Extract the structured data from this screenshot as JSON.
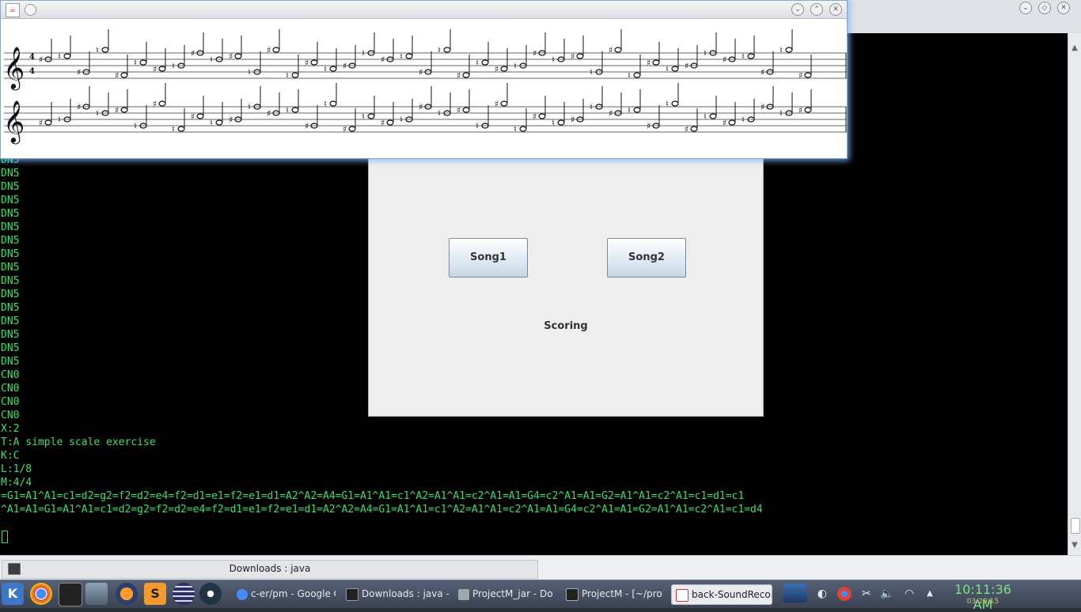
{
  "terminal": {
    "lines": [
      "DN5",
      "DN5",
      "DN5",
      "DN5",
      "DN5",
      "DN5",
      "DN5",
      "DN5",
      "DN5",
      "DN5",
      "DN5",
      "DN5",
      "DN5",
      "DN5",
      "DN5",
      "DN5",
      "CN0",
      "CN0",
      "CN0",
      "CN0",
      "X:2",
      "T:A simple scale exercise",
      "K:C",
      "L:1/8",
      "M:4/4",
      "=G1=A1^A1=c1=d2=g2=f2=d2=e4=f2=d1=e1=f2=e1=d1=A2^A2=A4=G1=A1^A1=c1^A2=A1^A1=c2^A1=A1=G4=c2^A1=A1=G2=A1^A1=c2^A1=c1=d1=c1",
      "^A1=A1=G1=A1^A1=c1=d2=g2=f2=d2=e4=f2=d1=e1=f2=e1=d1=A2^A2=A4=G1=A1^A1=c1^A2=A1^A1=c2^A1=A1=G4=c2^A1=A1=G2=A1^A1=c2^A1=c1=d4"
    ]
  },
  "main_window": {
    "song1_label": "Song1",
    "song2_label": "Song2",
    "scoring_label": "Scoring"
  },
  "sheet_window": {
    "time_signature_top": "4",
    "time_signature_bottom": "4"
  },
  "taskbar_window": {
    "label": "Downloads : java"
  },
  "panel": {
    "tasks": [
      {
        "label": "c-er/pm - Google C",
        "icon": "chrome-icon"
      },
      {
        "label": "Downloads : java -",
        "icon": "terminal-icon"
      },
      {
        "label": "ProjectM_jar - Do",
        "icon": "file-manager-icon"
      },
      {
        "label": "ProjectM - [~/pro",
        "icon": "intellij-icon"
      },
      {
        "label": "back-SoundRecord",
        "icon": "java-icon"
      }
    ],
    "clock": "10:11:36 AM",
    "date": "03/29/15"
  }
}
